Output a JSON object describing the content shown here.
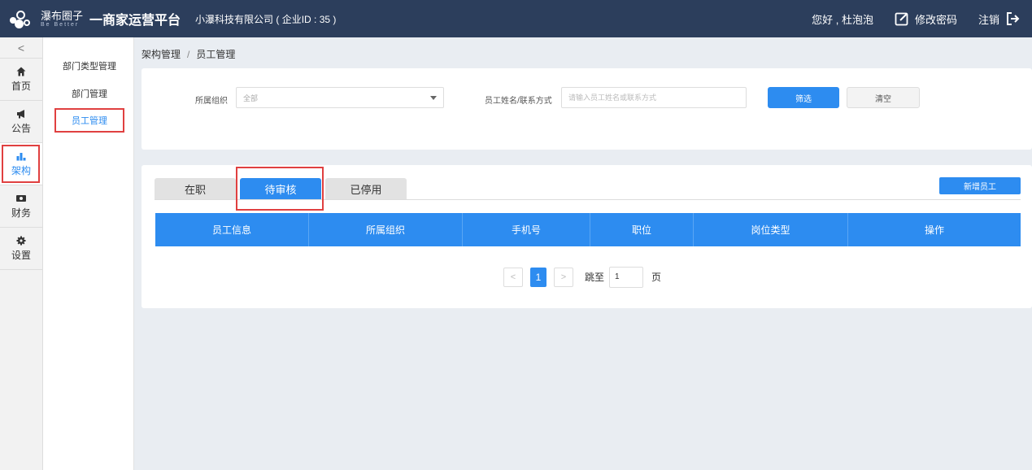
{
  "header": {
    "logo_cn": "瀑布圈子",
    "logo_en": "Be Better",
    "platform_title": "一商家运营平台",
    "company": "小瀑科技有限公司 ( 企业ID : 35 )",
    "greeting": "您好 , 杜泡泡",
    "change_password": "修改密码",
    "logout": "注销"
  },
  "iconbar": {
    "collapse": "<",
    "items": [
      {
        "label": "首页",
        "icon": "home-icon"
      },
      {
        "label": "公告",
        "icon": "megaphone-icon"
      },
      {
        "label": "架构",
        "icon": "bar-chart-icon",
        "active": true
      },
      {
        "label": "财务",
        "icon": "money-icon"
      },
      {
        "label": "设置",
        "icon": "gear-icon"
      }
    ]
  },
  "subnav": {
    "items": [
      {
        "label": "部门类型管理"
      },
      {
        "label": "部门管理"
      },
      {
        "label": "员工管理",
        "active": true
      }
    ]
  },
  "breadcrumb": {
    "parent": "架构管理",
    "separator": "/",
    "current": "员工管理"
  },
  "filter": {
    "org_label": "所属组织",
    "org_value": "全部",
    "name_label": "员工姓名/联系方式",
    "name_placeholder": "请输入员工姓名或联系方式",
    "filter_button": "筛选",
    "clear_button": "清空"
  },
  "list": {
    "tabs": [
      {
        "label": "在职"
      },
      {
        "label": "待审核",
        "active": true
      },
      {
        "label": "已停用"
      }
    ],
    "add_button": "新增员工",
    "columns": [
      "员工信息",
      "所属组织",
      "手机号",
      "职位",
      "岗位类型",
      "操作"
    ]
  },
  "pager": {
    "prev": "<",
    "current_page": "1",
    "next": ">",
    "jump_label": "跳至",
    "jump_value": "1",
    "jump_suffix": "页"
  },
  "colors": {
    "topbar": "#2c3e5c",
    "accent": "#2d8cf0",
    "highlight_border": "#e04040"
  }
}
